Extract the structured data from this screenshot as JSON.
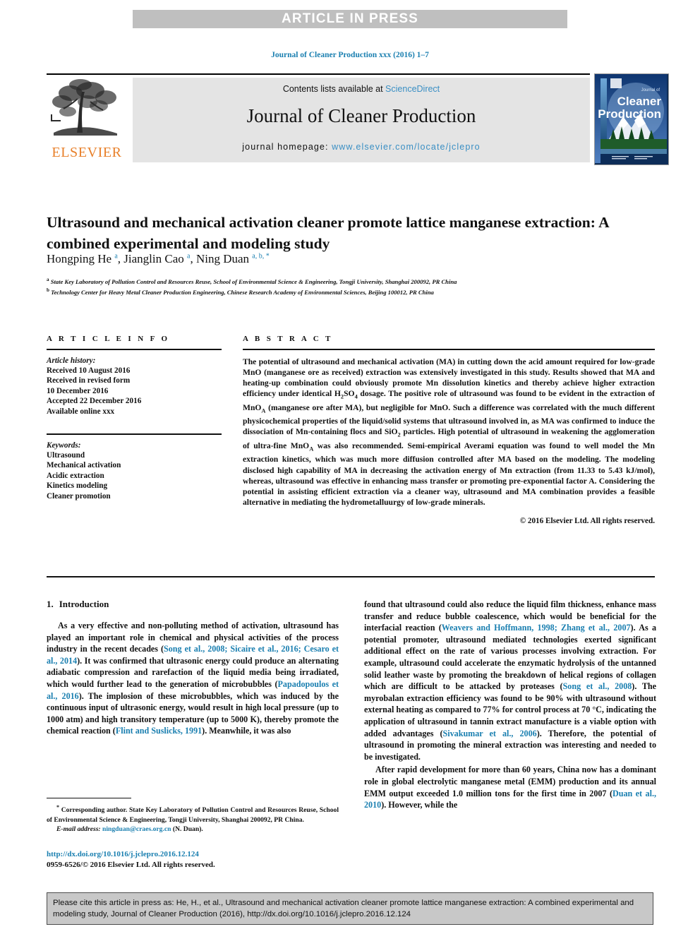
{
  "banner": {
    "label": "ARTICLE IN PRESS"
  },
  "running_head": {
    "text": "Journal of Cleaner Production xxx (2016) 1–7"
  },
  "masthead": {
    "contents_prefix": "Contents lists available at ",
    "sciencedirect": "ScienceDirect",
    "journal_title": "Journal of Cleaner Production",
    "homepage_prefix": "journal homepage: ",
    "homepage_url": "www.elsevier.com/locate/jclepro",
    "publisher": "ELSEVIER",
    "logo_icon": "elsevier-tree-icon",
    "cover_icon": "journal-cover-thumbnail",
    "cover_title_small": "Journal of",
    "cover_title_line1": "Cleaner",
    "cover_title_line2": "Production"
  },
  "article": {
    "title": "Ultrasound and mechanical activation cleaner promote lattice manganese extraction: A combined experimental and modeling study",
    "authors_html": "Hongping He <sup>a</sup>, Jianglin Cao <sup>a</sup>, Ning Duan <sup>a, b, *</sup>",
    "affiliation_a": "State Key Laboratory of Pollution Control and Resources Reuse, School of Environmental Science & Engineering, Tongji University, Shanghai 200092, PR China",
    "affiliation_b": "Technology Center for Heavy Metal Cleaner Production Engineering, Chinese Research Academy of Environmental Sciences, Beijing 100012, PR China"
  },
  "article_info": {
    "heading": "A R T I C L E   I N F O",
    "history_label": "Article history:",
    "history": [
      "Received 10 August 2016",
      "Received in revised form",
      "10 December 2016",
      "Accepted 22 December 2016",
      "Available online xxx"
    ],
    "keywords_label": "Keywords:",
    "keywords": [
      "Ultrasound",
      "Mechanical activation",
      "Acidic extraction",
      "Kinetics modeling",
      "Cleaner promotion"
    ]
  },
  "abstract": {
    "heading": "A B S T R A C T",
    "text_html": "The potential of ultrasound and mechanical activation (MA) in cutting down the acid amount required for low-grade MnO (manganese ore as received) extraction was extensively investigated in this study. Results showed that MA and heating-up combination could obviously promote Mn dissolution kinetics and thereby achieve higher extraction efficiency under identical H<sub>2</sub>SO<sub>4</sub> dosage. The positive role of ultrasound was found to be evident in the extraction of MnO<sub>A</sub> (manganese ore after MA), but negligible for MnO. Such a difference was correlated with the much different physicochemical properties of the liquid/solid systems that ultrasound involved in, as MA was confirmed to induce the dissociation of Mn-containing flocs and SiO<sub>2</sub> particles. High potential of ultrasound in weakening the agglomeration of ultra-fine MnO<sub>A</sub> was also recommended. Semi-empirical Averami equation was found to well model the Mn extraction kinetics, which was much more diffusion controlled after MA based on the modeling. The modeling disclosed high capability of MA in decreasing the activation energy of Mn extraction (from 11.33 to 5.43 kJ/mol), whereas, ultrasound was effective in enhancing mass transfer or promoting pre-exponential factor A. Considering the potential in assisting efficient extraction via a cleaner way, ultrasound and MA combination provides a feasible alternative in mediating the hydrometalluurgy of low-grade minerals.",
    "copyright": "© 2016 Elsevier Ltd. All rights reserved."
  },
  "body": {
    "section1_number": "1.",
    "section1_title": "Introduction",
    "left_p1_html": "As a very effective and non-polluting method of activation, ultrasound has played an important role in chemical and physical activities of the process industry in the recent decades (<span class=\"cite\">Song et al., 2008; Sicaire et al., 2016; Cesaro et al., 2014</span>). It was confirmed that ultrasonic energy could produce an alternating adiabatic compression and rarefaction of the liquid media being irradiated, which would further lead to the generation of microbubbles (<span class=\"cite\">Papadopoulos et al., 2016</span>). The implosion of these microbubbles, which was induced by the continuous input of ultrasonic energy, would result in high local pressure (up to 1000 atm) and high transitory temperature (up to 5000 K), thereby promote the chemical reaction (<span class=\"cite\">Flint and Suslicks, 1991</span>). Meanwhile, it was also",
    "right_p1_html": "found that ultrasound could also reduce the liquid film thickness, enhance mass transfer and reduce bubble coalescence, which would be beneficial for the interfacial reaction (<span class=\"cite\">Weavers and Hoffmann, 1998; Zhang et al., 2007</span>). As a potential promoter, ultrasound mediated technologies exerted significant additional effect on the rate of various processes involving extraction. For example, ultrasound could accelerate the enzymatic hydrolysis of the untanned solid leather waste by promoting the breakdown of helical regions of collagen which are difficult to be attacked by proteases (<span class=\"cite\">Song et al., 2008</span>). The myrobalan extraction efficiency was found to be 90% with ultrasound without external heating as compared to 77% for control process at 70 °C, indicating the application of ultrasound in tannin extract manufacture is a viable option with added advantages (<span class=\"cite\">Sivakumar et al., 2006</span>). Therefore, the potential of ultrasound in promoting the mineral extraction was interesting and needed to be investigated.",
    "right_p2_html": "After rapid development for more than 60 years, China now has a dominant role in global electrolytic manganese metal (EMM) production and its annual EMM output exceeded 1.0 million tons for the first time in 2007 (<span class=\"cite\">Duan et al., 2010</span>). However, while the"
  },
  "footnote": {
    "corresponding_html": "<sup>*</sup> Corresponding author. State Key Laboratory of Pollution Control and Resources Reuse, School of Environmental Science & Engineering, Tongji University, Shanghai 200092, PR China.",
    "email_label": "E-mail address:",
    "email": "ningduan@craes.org.cn",
    "email_owner": "(N. Duan).",
    "doi": "http://dx.doi.org/10.1016/j.jclepro.2016.12.124",
    "issn": "0959-6526/© 2016 Elsevier Ltd. All rights reserved."
  },
  "cite_box": {
    "text": "Please cite this article in press as: He, H., et al., Ultrasound and mechanical activation cleaner promote lattice manganese extraction: A combined experimental and modeling study, Journal of Cleaner Production (2016), http://dx.doi.org/10.1016/j.jclepro.2016.12.124"
  },
  "colors": {
    "banner_bg": "#bfbfbf",
    "link_blue": "#1a7fb0",
    "elsevier_orange": "#e8802a",
    "masthead_bg": "#e4e4e4",
    "cite_box_bg": "#c8c8c8"
  }
}
